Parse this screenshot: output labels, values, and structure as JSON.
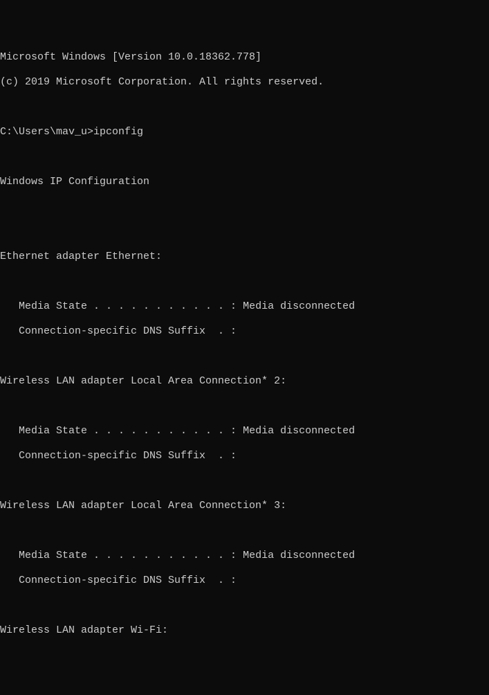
{
  "header": {
    "version_line": "Microsoft Windows [Version 10.0.18362.778]",
    "copyright_line": "(c) 2019 Microsoft Corporation. All rights reserved."
  },
  "prompt": {
    "path": "C:\\Users\\mav_u>",
    "command": "ipconfig"
  },
  "title": "Windows IP Configuration",
  "adapters": [
    {
      "name": "Ethernet adapter Ethernet:",
      "media_state_label": "   Media State . . . . . . . . . . . : ",
      "media_state_value": "Media disconnected",
      "dns_suffix_label": "   Connection-specific DNS Suffix  . :",
      "dns_suffix_value": ""
    },
    {
      "name": "Wireless LAN adapter Local Area Connection* 2:",
      "media_state_label": "   Media State . . . . . . . . . . . : ",
      "media_state_value": "Media disconnected",
      "dns_suffix_label": "   Connection-specific DNS Suffix  . :",
      "dns_suffix_value": ""
    },
    {
      "name": "Wireless LAN adapter Local Area Connection* 3:",
      "media_state_label": "   Media State . . . . . . . . . . . : ",
      "media_state_value": "Media disconnected",
      "dns_suffix_label": "   Connection-specific DNS Suffix  . :",
      "dns_suffix_value": ""
    },
    {
      "name": "Wireless LAN adapter Wi-Fi:"
    }
  ]
}
